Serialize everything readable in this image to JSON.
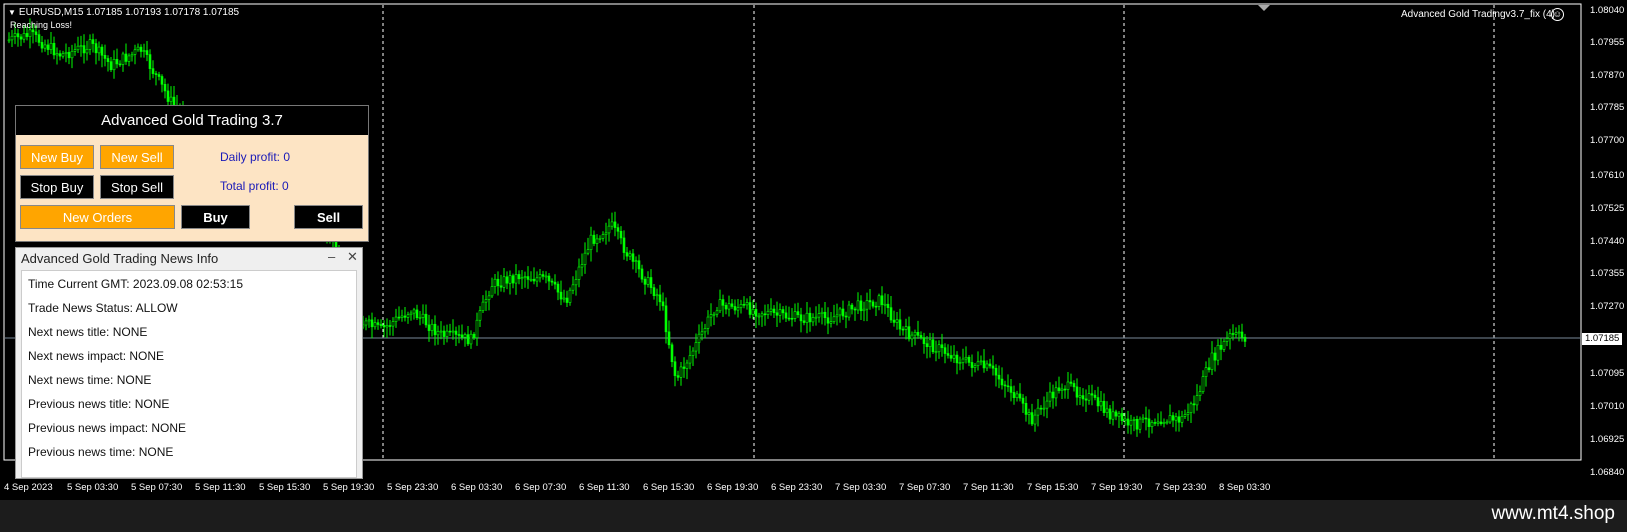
{
  "chart": {
    "symbol_info": "EURUSD,M15  1.07185 1.07193 1.07178 1.07185",
    "status_note": "Reaching Loss!",
    "ea_label": "Advanced Gold Tradingv3.7_fix (4)",
    "current_price": "1.07185",
    "price_axis": [
      "1.08040",
      "1.07955",
      "1.07870",
      "1.07785",
      "1.07700",
      "1.07610",
      "1.07525",
      "1.07440",
      "1.07355",
      "1.07270",
      "1.07095",
      "1.07010",
      "1.06925",
      "1.06840"
    ],
    "time_axis": [
      "4 Sep 2023",
      "5 Sep 03:30",
      "5 Sep 07:30",
      "5 Sep 11:30",
      "5 Sep 15:30",
      "5 Sep 19:30",
      "5 Sep 23:30",
      "6 Sep 03:30",
      "6 Sep 07:30",
      "6 Sep 11:30",
      "6 Sep 15:30",
      "6 Sep 19:30",
      "6 Sep 23:30",
      "7 Sep 03:30",
      "7 Sep 07:30",
      "7 Sep 11:30",
      "7 Sep 15:30",
      "7 Sep 19:30",
      "7 Sep 23:30",
      "8 Sep 03:30"
    ],
    "colors": {
      "background": "#000000",
      "bull": "#00ff00",
      "bear": "#00ff00",
      "grid": "#ffffff",
      "price_line": "#778899"
    }
  },
  "control_panel": {
    "title": "Advanced Gold Trading 3.7",
    "new_buy": "New Buy",
    "new_sell": "New Sell",
    "stop_buy": "Stop Buy",
    "stop_sell": "Stop Sell",
    "new_orders": "New Orders",
    "buy": "Buy",
    "sell": "Sell",
    "daily_profit": "Daily profit: 0",
    "total_profit": "Total profit:  0",
    "colors": {
      "panel_bg": "#fde4c4",
      "orange": "#ffa500",
      "profit_text": "#1a1ab8"
    }
  },
  "news_panel": {
    "title": "Advanced Gold Trading News Info",
    "minimize": "–",
    "close": "✕",
    "lines": [
      "Time Current GMT: 2023.09.08 02:53:15",
      "Trade News Status: ALLOW",
      "Next news title: NONE",
      "Next news impact: NONE",
      "Next news time: NONE",
      "Previous news title: NONE",
      "Previous news impact: NONE",
      "Previous news time: NONE"
    ]
  },
  "footer": {
    "url": "www.mt4.shop"
  }
}
